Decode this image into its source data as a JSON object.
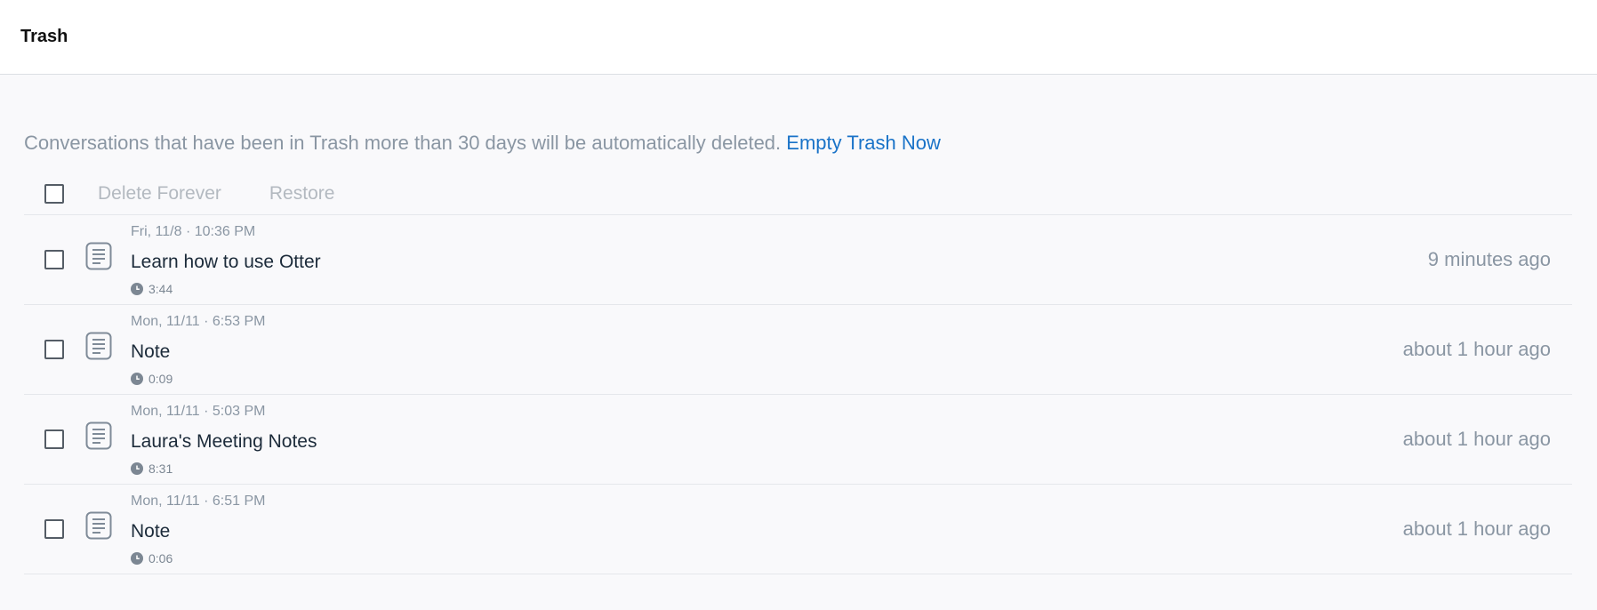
{
  "header": {
    "title": "Trash"
  },
  "notice": {
    "text": "Conversations that have been in Trash more than 30 days will be automatically deleted. ",
    "link": "Empty Trash Now"
  },
  "toolbar": {
    "delete_label": "Delete Forever",
    "restore_label": "Restore"
  },
  "icons": {
    "item": "document-icon",
    "duration": "clock-icon",
    "checkbox": "checkbox"
  },
  "colors": {
    "link": "#1a73c8",
    "muted": "#8a96a3",
    "title": "#1c2b3a"
  },
  "items": [
    {
      "date": "Fri, 11/8 · 10:36 PM",
      "title": "Learn how to use Otter",
      "duration": "3:44",
      "ago": "9 minutes ago"
    },
    {
      "date": "Mon, 11/11 · 6:53 PM",
      "title": "Note",
      "duration": "0:09",
      "ago": "about 1 hour ago"
    },
    {
      "date": "Mon, 11/11 · 5:03 PM",
      "title": "Laura's Meeting Notes",
      "duration": "8:31",
      "ago": "about 1 hour ago"
    },
    {
      "date": "Mon, 11/11 · 6:51 PM",
      "title": "Note",
      "duration": "0:06",
      "ago": "about 1 hour ago"
    }
  ]
}
